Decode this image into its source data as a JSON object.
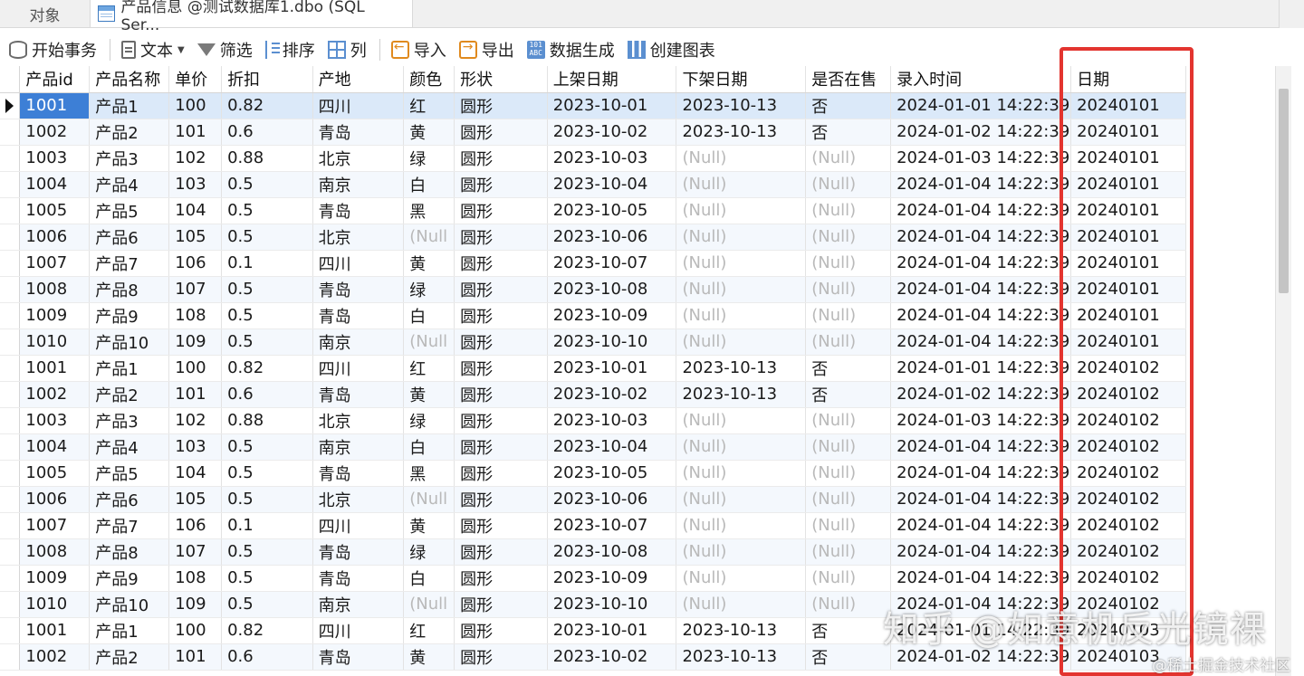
{
  "tabs": [
    {
      "label": "对象",
      "active": false
    },
    {
      "label": "产品信息 @测试数据库1.dbo (SQL Ser...",
      "active": true
    }
  ],
  "toolbar": {
    "begin_transaction": "开始事务",
    "text": "文本",
    "filter": "筛选",
    "sort": "排序",
    "columns": "列",
    "import": "导入",
    "export": "导出",
    "data_generation": "数据生成",
    "create_chart": "创建图表"
  },
  "grid": {
    "columns": [
      "产品id",
      "产品名称",
      "单价",
      "折扣",
      "产地",
      "颜色",
      "形状",
      "上架日期",
      "下架日期",
      "是否在售",
      "录入时间",
      "日期"
    ],
    "null_label": "(Null)",
    "null_label_truncated": "(Null",
    "selected_row_index": 0,
    "rows": [
      [
        "1001",
        "产品1",
        "100",
        "0.82",
        "四川",
        "红",
        "圆形",
        "2023-10-01",
        "2023-10-13",
        "否",
        "2024-01-01 14:22:39",
        "20240101"
      ],
      [
        "1002",
        "产品2",
        "101",
        "0.6",
        "青岛",
        "黄",
        "圆形",
        "2023-10-02",
        "2023-10-13",
        "否",
        "2024-01-02 14:22:39",
        "20240101"
      ],
      [
        "1003",
        "产品3",
        "102",
        "0.88",
        "北京",
        "绿",
        "圆形",
        "2023-10-03",
        null,
        null,
        "2024-01-03 14:22:39",
        "20240101"
      ],
      [
        "1004",
        "产品4",
        "103",
        "0.5",
        "南京",
        "白",
        "圆形",
        "2023-10-04",
        null,
        null,
        "2024-01-04 14:22:39",
        "20240101"
      ],
      [
        "1005",
        "产品5",
        "104",
        "0.5",
        "青岛",
        "黑",
        "圆形",
        "2023-10-05",
        null,
        null,
        "2024-01-04 14:22:39",
        "20240101"
      ],
      [
        "1006",
        "产品6",
        "105",
        "0.5",
        "北京",
        null,
        "圆形",
        "2023-10-06",
        null,
        null,
        "2024-01-04 14:22:39",
        "20240101"
      ],
      [
        "1007",
        "产品7",
        "106",
        "0.1",
        "四川",
        "黄",
        "圆形",
        "2023-10-07",
        null,
        null,
        "2024-01-04 14:22:39",
        "20240101"
      ],
      [
        "1008",
        "产品8",
        "107",
        "0.5",
        "青岛",
        "绿",
        "圆形",
        "2023-10-08",
        null,
        null,
        "2024-01-04 14:22:39",
        "20240101"
      ],
      [
        "1009",
        "产品9",
        "108",
        "0.5",
        "青岛",
        "白",
        "圆形",
        "2023-10-09",
        null,
        null,
        "2024-01-04 14:22:39",
        "20240101"
      ],
      [
        "1010",
        "产品10",
        "109",
        "0.5",
        "南京",
        null,
        "圆形",
        "2023-10-10",
        null,
        null,
        "2024-01-04 14:22:39",
        "20240101"
      ],
      [
        "1001",
        "产品1",
        "100",
        "0.82",
        "四川",
        "红",
        "圆形",
        "2023-10-01",
        "2023-10-13",
        "否",
        "2024-01-01 14:22:39",
        "20240102"
      ],
      [
        "1002",
        "产品2",
        "101",
        "0.6",
        "青岛",
        "黄",
        "圆形",
        "2023-10-02",
        "2023-10-13",
        "否",
        "2024-01-02 14:22:39",
        "20240102"
      ],
      [
        "1003",
        "产品3",
        "102",
        "0.88",
        "北京",
        "绿",
        "圆形",
        "2023-10-03",
        null,
        null,
        "2024-01-03 14:22:39",
        "20240102"
      ],
      [
        "1004",
        "产品4",
        "103",
        "0.5",
        "南京",
        "白",
        "圆形",
        "2023-10-04",
        null,
        null,
        "2024-01-04 14:22:39",
        "20240102"
      ],
      [
        "1005",
        "产品5",
        "104",
        "0.5",
        "青岛",
        "黑",
        "圆形",
        "2023-10-05",
        null,
        null,
        "2024-01-04 14:22:39",
        "20240102"
      ],
      [
        "1006",
        "产品6",
        "105",
        "0.5",
        "北京",
        null,
        "圆形",
        "2023-10-06",
        null,
        null,
        "2024-01-04 14:22:39",
        "20240102"
      ],
      [
        "1007",
        "产品7",
        "106",
        "0.1",
        "四川",
        "黄",
        "圆形",
        "2023-10-07",
        null,
        null,
        "2024-01-04 14:22:39",
        "20240102"
      ],
      [
        "1008",
        "产品8",
        "107",
        "0.5",
        "青岛",
        "绿",
        "圆形",
        "2023-10-08",
        null,
        null,
        "2024-01-04 14:22:39",
        "20240102"
      ],
      [
        "1009",
        "产品9",
        "108",
        "0.5",
        "青岛",
        "白",
        "圆形",
        "2023-10-09",
        null,
        null,
        "2024-01-04 14:22:39",
        "20240102"
      ],
      [
        "1010",
        "产品10",
        "109",
        "0.5",
        "南京",
        null,
        "圆形",
        "2023-10-10",
        null,
        null,
        "2024-01-04 14:22:39",
        "20240102"
      ],
      [
        "1001",
        "产品1",
        "100",
        "0.82",
        "四川",
        "红",
        "圆形",
        "2023-10-01",
        "2023-10-13",
        "否",
        "2024-01-01 14:22:39",
        "20240103"
      ],
      [
        "1002",
        "产品2",
        "101",
        "0.6",
        "青岛",
        "黄",
        "圆形",
        "2023-10-02",
        "2023-10-13",
        "否",
        "2024-01-02 14:22:39",
        "20240103"
      ]
    ]
  },
  "watermark": {
    "large": "知乎 @如意机反光镜裸",
    "small": "@稀土掘金技术社区"
  },
  "colors": {
    "highlight_border": "#e3342f",
    "selected_cell": "#3d7fd6",
    "null_text": "#b9b9b9"
  }
}
